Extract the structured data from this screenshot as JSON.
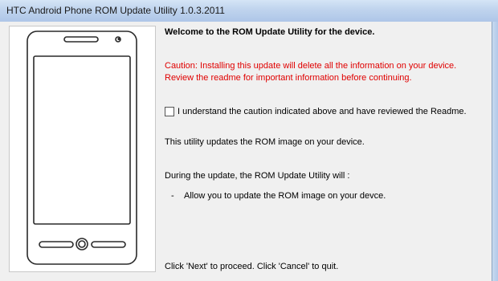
{
  "window": {
    "title": "HTC Android Phone ROM Update Utility 1.0.3.2011"
  },
  "content": {
    "welcome_heading": "Welcome to the ROM Update Utility for the device.",
    "caution_text": "Caution: Installing this update will delete all the information on your device. Review the readme for important information before continuing.",
    "checkbox": {
      "checked": false,
      "label": "I understand the caution indicated above and have reviewed the Readme."
    },
    "info_text": "This utility updates the ROM image on your device.",
    "during_text": "During the update, the ROM Update Utility will :",
    "list": [
      {
        "bullet": "-",
        "text": "Allow you to update the ROM image on your devce."
      }
    ],
    "proceed_text": "Click 'Next' to proceed. Click 'Cancel' to quit."
  },
  "colors": {
    "caution": "#e00000",
    "titlebar": "#c1d5ee"
  },
  "icons": [
    "phone-illustration-icon"
  ]
}
